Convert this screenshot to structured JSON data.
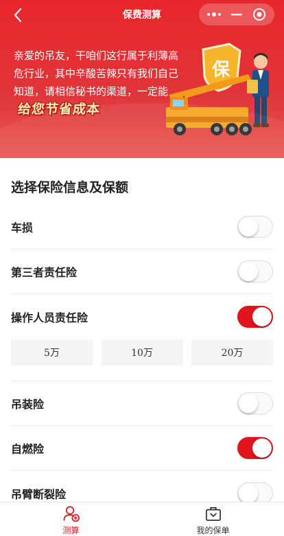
{
  "nav": {
    "title": "保费测算",
    "back_icon": "chevron-left-icon",
    "capsule": [
      "more-dots-icon",
      "minimize-icon",
      "target-icon"
    ]
  },
  "banner": {
    "text": "亲爱的吊友，干咱们这行属于利薄高危行业，其中辛酸苦辣只有我们自己知道，请相信秘书的渠道，一定能",
    "highlight": "给您节省成本",
    "badge_char": "保"
  },
  "section_title": "选择保险信息及保额",
  "options": [
    {
      "label": "车损",
      "on": false
    },
    {
      "label": "第三者责任险",
      "on": false
    },
    {
      "label": "操作人员责任险",
      "on": true
    },
    {
      "label": "吊装险",
      "on": false
    },
    {
      "label": "自燃险",
      "on": true
    },
    {
      "label": "吊臂断裂险",
      "on": false
    }
  ],
  "amounts": [
    "5万",
    "10万",
    "20万"
  ],
  "tabbar": [
    {
      "label": "测算",
      "icon": "user-add-icon",
      "active": true
    },
    {
      "label": "我的保单",
      "icon": "briefcase-icon",
      "active": false
    }
  ],
  "colors": {
    "accent": "#e0141b",
    "header_bg": "#e8262a"
  }
}
